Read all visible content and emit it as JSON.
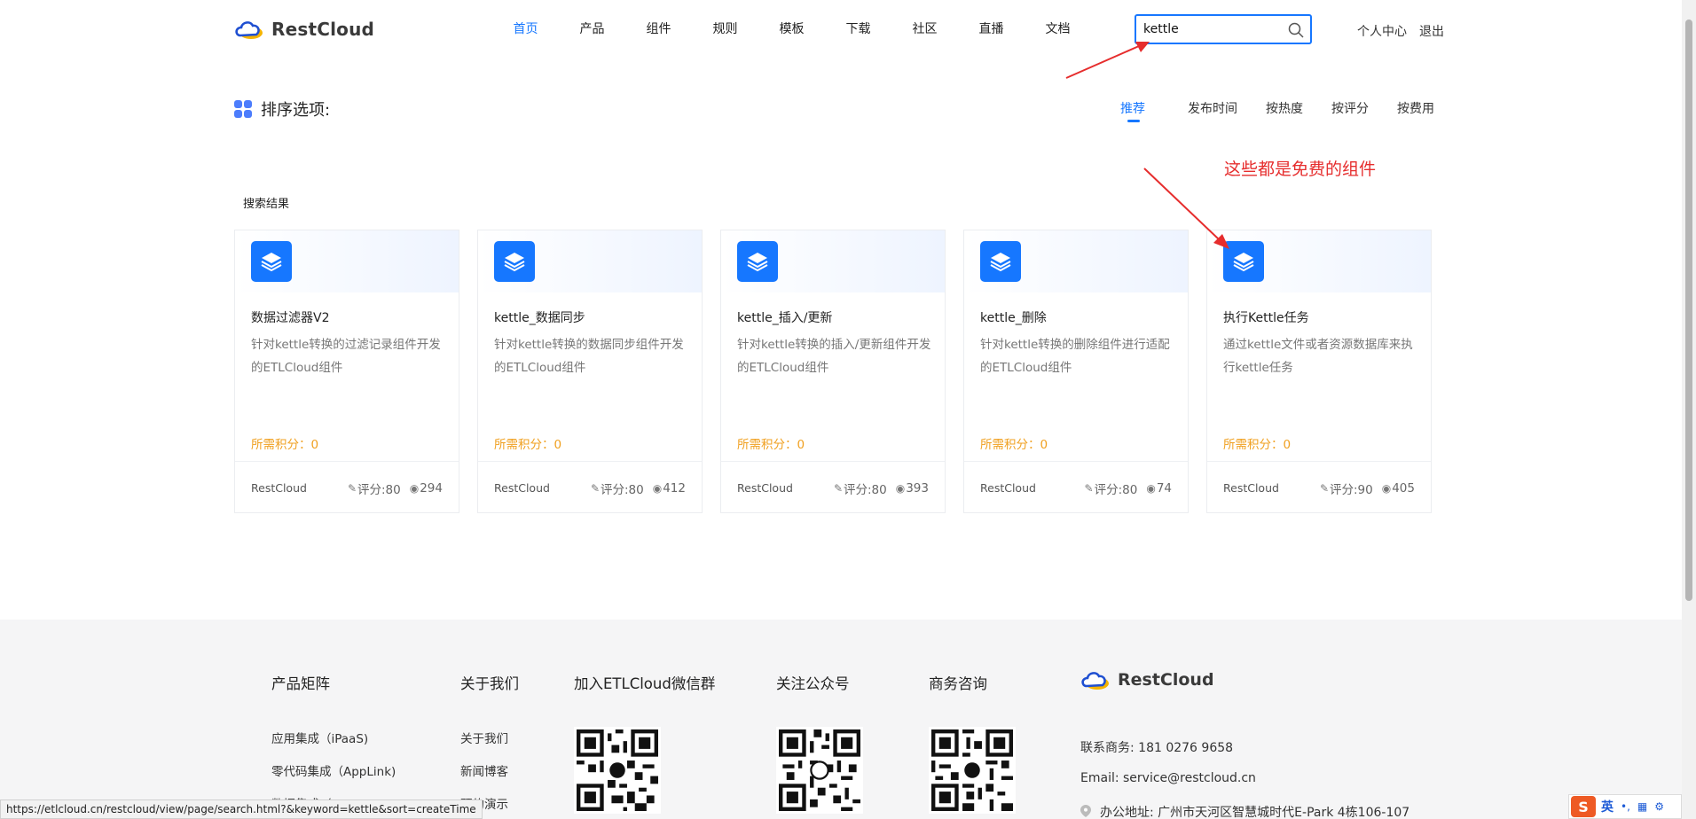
{
  "header": {
    "brand": "RestCloud",
    "nav": [
      "首页",
      "产品",
      "组件",
      "规则",
      "模板",
      "下载",
      "社区",
      "直播",
      "文档"
    ],
    "active_nav": "首页",
    "search": {
      "value": "kettle",
      "placeholder": ""
    },
    "user_center": "个人中心",
    "logout": "退出"
  },
  "annotation": {
    "text": "这些都是免费的组件",
    "color": "#e62d2d"
  },
  "sort": {
    "title": "排序选项:",
    "options": [
      "推荐",
      "发布时间",
      "按热度",
      "按评分",
      "按费用"
    ],
    "active": "推荐"
  },
  "results": {
    "title": "搜索结果",
    "cards": [
      {
        "title": "数据过滤器V2",
        "desc": "针对kettle转换的过滤记录组件开发的ETLCloud组件",
        "points": "所需积分：0",
        "author": "RestCloud",
        "score": "评分:80",
        "views": "294"
      },
      {
        "title": "kettle_数据同步",
        "desc": "针对kettle转换的数据同步组件开发的ETLCloud组件",
        "points": "所需积分：0",
        "author": "RestCloud",
        "score": "评分:80",
        "views": "412"
      },
      {
        "title": "kettle_插入/更新",
        "desc": "针对kettle转换的插入/更新组件开发的ETLCloud组件",
        "points": "所需积分：0",
        "author": "RestCloud",
        "score": "评分:80",
        "views": "393"
      },
      {
        "title": "kettle_删除",
        "desc": "针对kettle转换的删除组件进行适配的ETLCloud组件",
        "points": "所需积分：0",
        "author": "RestCloud",
        "score": "评分:80",
        "views": "74"
      },
      {
        "title": "执行Kettle任务",
        "desc": "通过kettle文件或者资源数据库来执行kettle任务",
        "points": "所需积分：0",
        "author": "RestCloud",
        "score": "评分:90",
        "views": "405"
      }
    ]
  },
  "footer": {
    "products": {
      "title": "产品矩阵",
      "links": [
        "应用集成（iPaaS)",
        "零代码集成（AppLink)",
        "数据集成（ETLCloud)"
      ]
    },
    "about": {
      "title": "关于我们",
      "links": [
        "关于我们",
        "新闻博客",
        "预约演示"
      ]
    },
    "wechat_group": {
      "title": "加入ETLCloud微信群"
    },
    "official_account": {
      "title": "关注公众号"
    },
    "business": {
      "title": "商务咨询"
    },
    "brand": "RestCloud",
    "phone": "联系商务: 181 0276 9658",
    "email": "Email: service@restcloud.cn",
    "address": "办公地址: 广州市天河区智慧城时代E-Park 4栋106-107"
  },
  "status_url": "https://etlcloud.cn/restcloud/view/page/search.html?&keyword=kettle&sort=createTime",
  "ime": {
    "logo": "S",
    "lang": "英"
  },
  "colors": {
    "accent": "#1677ff",
    "points": "#f0a020",
    "annotation": "#e62d2d"
  }
}
